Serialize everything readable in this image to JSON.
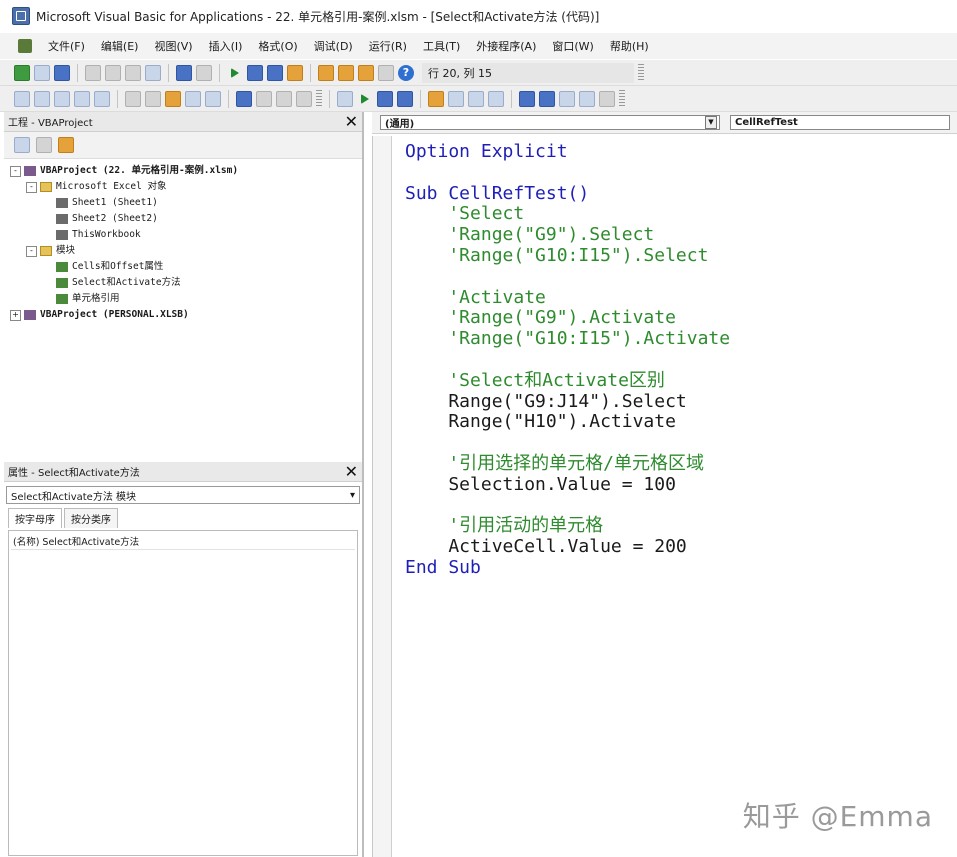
{
  "window": {
    "title": "Microsoft Visual Basic for Applications - 22. 单元格引用-案例.xlsm - [Select和Activate方法 (代码)]"
  },
  "menu": {
    "items": [
      "文件(F)",
      "编辑(E)",
      "视图(V)",
      "插入(I)",
      "格式(O)",
      "调试(D)",
      "运行(R)",
      "工具(T)",
      "外接程序(A)",
      "窗口(W)",
      "帮助(H)"
    ]
  },
  "toolbar": {
    "position_readout": "行 20, 列 15"
  },
  "project_pane": {
    "title": "工程 - VBAProject",
    "tree": [
      {
        "expander": "-",
        "icon": "project",
        "label": "VBAProject (22. 单元格引用-案例.xlsm)",
        "bold": true,
        "depth": 0
      },
      {
        "expander": "-",
        "icon": "folder",
        "label": "Microsoft Excel 对象",
        "bold": false,
        "depth": 1
      },
      {
        "expander": "",
        "icon": "sheet",
        "label": "Sheet1 (Sheet1)",
        "bold": false,
        "depth": 2
      },
      {
        "expander": "",
        "icon": "sheet",
        "label": "Sheet2 (Sheet2)",
        "bold": false,
        "depth": 2
      },
      {
        "expander": "",
        "icon": "sheet",
        "label": "ThisWorkbook",
        "bold": false,
        "depth": 2
      },
      {
        "expander": "-",
        "icon": "folder",
        "label": "模块",
        "bold": false,
        "depth": 1
      },
      {
        "expander": "",
        "icon": "module",
        "label": "Cells和Offset属性",
        "bold": false,
        "depth": 2
      },
      {
        "expander": "",
        "icon": "module",
        "label": "Select和Activate方法",
        "bold": false,
        "depth": 2
      },
      {
        "expander": "",
        "icon": "module",
        "label": "单元格引用",
        "bold": false,
        "depth": 2
      },
      {
        "expander": "+",
        "icon": "project",
        "label": "VBAProject (PERSONAL.XLSB)",
        "bold": true,
        "depth": 0
      }
    ]
  },
  "properties_pane": {
    "title": "属性 - Select和Activate方法",
    "object_select": "Select和Activate方法 模块",
    "tabs": [
      "按字母序",
      "按分类序"
    ],
    "rows": [
      "(名称) Select和Activate方法"
    ]
  },
  "code_window": {
    "object_dropdown": "(通用)",
    "procedure_dropdown": "CellRefTest",
    "lines": [
      {
        "text": "Option Explicit",
        "kind": "kw"
      },
      {
        "text": "",
        "kind": "plain"
      },
      {
        "text": "Sub CellRefTest()",
        "kind": "kw"
      },
      {
        "text": "    'Select",
        "kind": "cm"
      },
      {
        "text": "    'Range(\"G9\").Select",
        "kind": "cm"
      },
      {
        "text": "    'Range(\"G10:I15\").Select",
        "kind": "cm"
      },
      {
        "text": "",
        "kind": "plain"
      },
      {
        "text": "    'Activate",
        "kind": "cm"
      },
      {
        "text": "    'Range(\"G9\").Activate",
        "kind": "cm"
      },
      {
        "text": "    'Range(\"G10:I15\").Activate",
        "kind": "cm"
      },
      {
        "text": "",
        "kind": "plain"
      },
      {
        "text": "    'Select和Activate区别",
        "kind": "cm"
      },
      {
        "text": "    Range(\"G9:J14\").Select",
        "kind": "plain"
      },
      {
        "text": "    Range(\"H10\").Activate",
        "kind": "plain"
      },
      {
        "text": "",
        "kind": "plain"
      },
      {
        "text": "    '引用选择的单元格/单元格区域",
        "kind": "cm"
      },
      {
        "text": "    Selection.Value = 100",
        "kind": "plain"
      },
      {
        "text": "",
        "kind": "plain"
      },
      {
        "text": "    '引用活动的单元格",
        "kind": "cm"
      },
      {
        "text": "    ActiveCell.Value = 200",
        "kind": "plain"
      },
      {
        "text": "End Sub",
        "kind": "kw"
      }
    ]
  },
  "watermark": "知乎 @Emma"
}
